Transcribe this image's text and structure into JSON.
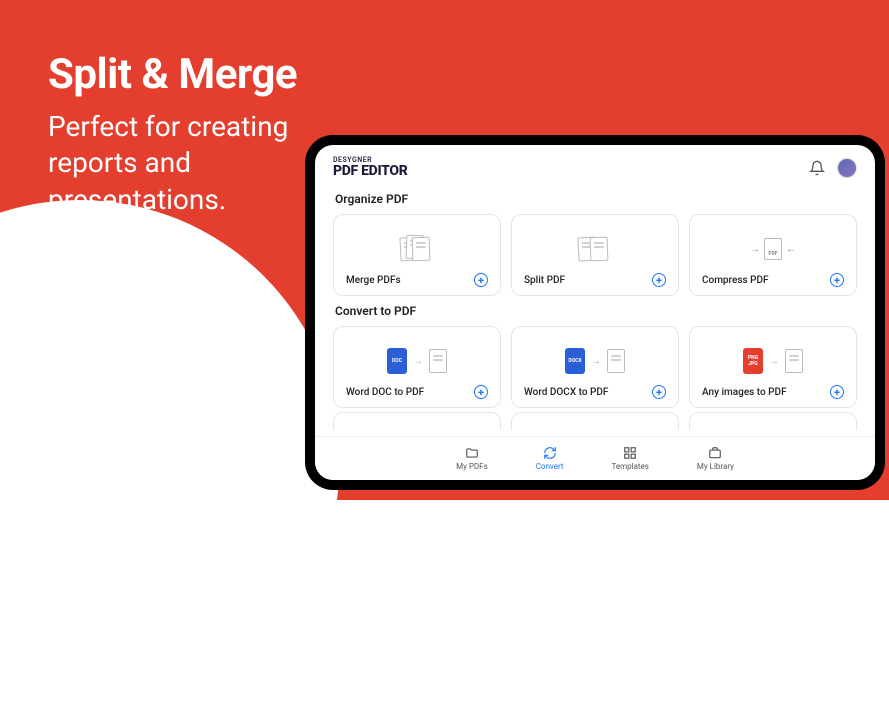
{
  "hero": {
    "title": "Split & Merge",
    "subtitle_line1": "Perfect for creating",
    "subtitle_line2": "reports and",
    "subtitle_line3": "presentations."
  },
  "header": {
    "brand_small": "DESYGNER",
    "brand_big": "PDF EDITOR"
  },
  "sections": {
    "organize": {
      "title": "Organize PDF",
      "cards": [
        {
          "label": "Merge PDFs"
        },
        {
          "label": "Split PDF"
        },
        {
          "label": "Compress PDF",
          "pdf_text": "PDF"
        }
      ]
    },
    "convert": {
      "title": "Convert to PDF",
      "cards": [
        {
          "label": "Word DOC to PDF",
          "badge_text": "DOC"
        },
        {
          "label": "Word DOCX to PDF",
          "badge_text": "DOCX"
        },
        {
          "label": "Any images to PDF",
          "badge_text1": "PNG",
          "badge_text2": "JPG"
        }
      ]
    }
  },
  "nav": {
    "items": [
      {
        "label": "My PDFs"
      },
      {
        "label": "Convert"
      },
      {
        "label": "Templates"
      },
      {
        "label": "My Library"
      }
    ],
    "active_index": 1
  }
}
